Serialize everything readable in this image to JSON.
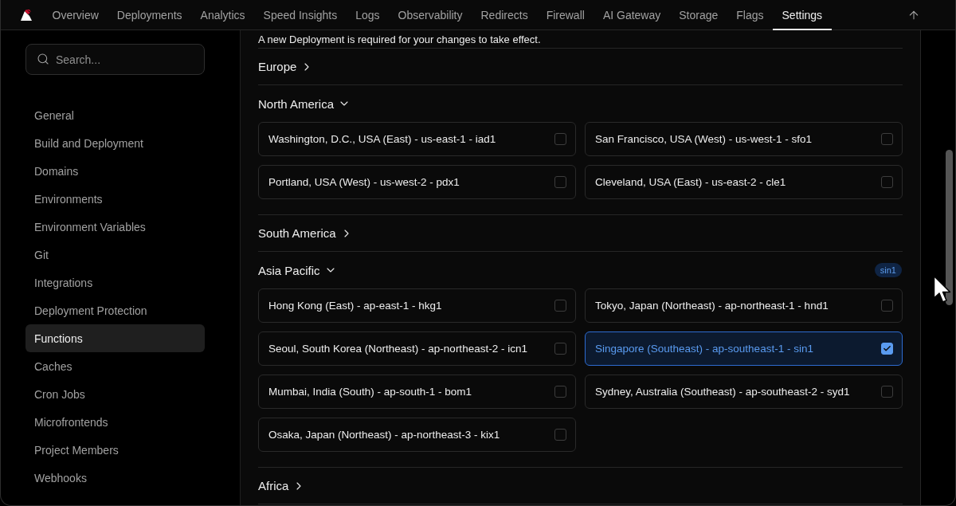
{
  "nav": {
    "items": [
      {
        "label": "Overview",
        "selected": false
      },
      {
        "label": "Deployments",
        "selected": false
      },
      {
        "label": "Analytics",
        "selected": false
      },
      {
        "label": "Speed Insights",
        "selected": false
      },
      {
        "label": "Logs",
        "selected": false
      },
      {
        "label": "Observability",
        "selected": false
      },
      {
        "label": "Redirects",
        "selected": false
      },
      {
        "label": "Firewall",
        "selected": false
      },
      {
        "label": "AI Gateway",
        "selected": false
      },
      {
        "label": "Storage",
        "selected": false
      },
      {
        "label": "Flags",
        "selected": false
      },
      {
        "label": "Settings",
        "selected": true
      }
    ]
  },
  "sidebar": {
    "search": {
      "placeholder": "Search..."
    },
    "items": [
      {
        "label": "General",
        "selected": false
      },
      {
        "label": "Build and Deployment",
        "selected": false
      },
      {
        "label": "Domains",
        "selected": false
      },
      {
        "label": "Environments",
        "selected": false
      },
      {
        "label": "Environment Variables",
        "selected": false
      },
      {
        "label": "Git",
        "selected": false
      },
      {
        "label": "Integrations",
        "selected": false
      },
      {
        "label": "Deployment Protection",
        "selected": false
      },
      {
        "label": "Functions",
        "selected": true
      },
      {
        "label": "Caches",
        "selected": false
      },
      {
        "label": "Cron Jobs",
        "selected": false
      },
      {
        "label": "Microfrontends",
        "selected": false
      },
      {
        "label": "Project Members",
        "selected": false
      },
      {
        "label": "Webhooks",
        "selected": false
      }
    ]
  },
  "notice": "A new Deployment is required for your changes to take effect.",
  "regions": [
    {
      "name": "Europe",
      "expanded": false
    },
    {
      "name": "North America",
      "expanded": true,
      "locations": [
        {
          "label": "Washington, D.C., USA (East) - us-east-1 - iad1",
          "checked": false
        },
        {
          "label": "San Francisco, USA (West) - us-west-1 - sfo1",
          "checked": false
        },
        {
          "label": "Portland, USA (West) - us-west-2 - pdx1",
          "checked": false
        },
        {
          "label": "Cleveland, USA (East) - us-east-2 - cle1",
          "checked": false
        }
      ]
    },
    {
      "name": "South America",
      "expanded": false
    },
    {
      "name": "Asia Pacific",
      "expanded": true,
      "badge": "sin1",
      "locations": [
        {
          "label": "Hong Kong (East) - ap-east-1 - hkg1",
          "checked": false
        },
        {
          "label": "Tokyo, Japan (Northeast) - ap-northeast-1 - hnd1",
          "checked": false
        },
        {
          "label": "Seoul, South Korea (Northeast) - ap-northeast-2 - icn1",
          "checked": false
        },
        {
          "label": "Singapore (Southeast) - ap-southeast-1 - sin1",
          "checked": true
        },
        {
          "label": "Mumbai, India (South) - ap-south-1 - bom1",
          "checked": false
        },
        {
          "label": "Sydney, Australia (Southeast) - ap-southeast-2 - syd1",
          "checked": false
        },
        {
          "label": "Osaka, Japan (Northeast) - ap-northeast-3 - kix1",
          "checked": false
        }
      ]
    },
    {
      "name": "Africa",
      "expanded": false
    }
  ]
}
